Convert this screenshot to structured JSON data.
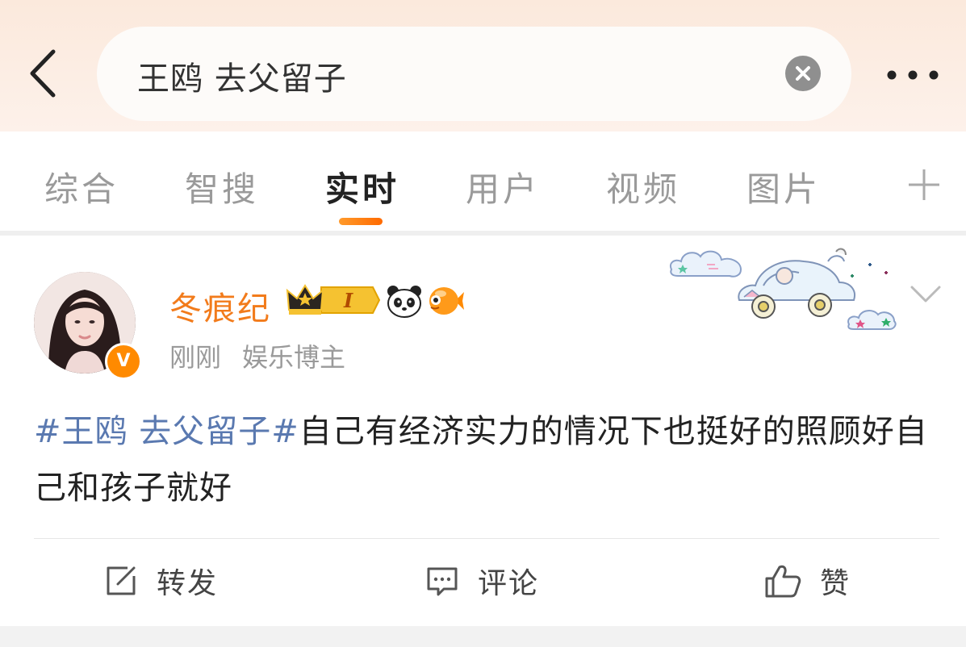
{
  "search": {
    "query": "王鸥 去父留子"
  },
  "tabs": [
    {
      "label": "综合"
    },
    {
      "label": "智搜"
    },
    {
      "label": "实时"
    },
    {
      "label": "用户"
    },
    {
      "label": "视频"
    },
    {
      "label": "图片"
    }
  ],
  "active_tab": "实时",
  "post": {
    "username": "冬痕纪",
    "vip_level": "I",
    "time": "刚刚",
    "role": "娱乐博主",
    "hashtag": "#王鸥 去父留子#",
    "text": "自己有经济实力的情况下也挺好的照顾好自己和孩子就好"
  },
  "actions": {
    "repost_label": "转发",
    "comment_label": "评论",
    "like_label": "赞"
  },
  "icons": {
    "back": "chevron-left-icon",
    "clear": "close-circle-icon",
    "more": "more-dots-icon",
    "add_tab": "plus-icon",
    "verified": "verified-v-icon",
    "repost": "share-edit-icon",
    "comment": "comment-bubble-icon",
    "like": "thumbs-up-icon"
  },
  "colors": {
    "accent": "#ff7a00",
    "username": "#f27b1b",
    "hashtag": "#5a79b0",
    "tab_inactive": "#9a9a9a",
    "topbar": "#fbe9dc"
  }
}
